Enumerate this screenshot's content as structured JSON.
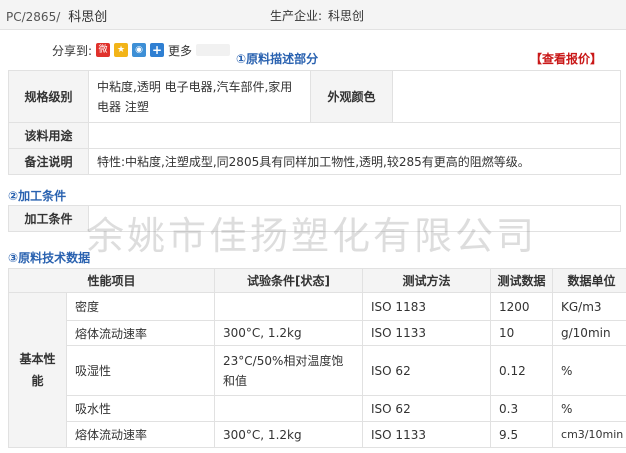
{
  "header": {
    "grade_code": "PC/2865/",
    "grade_brand": "科思创",
    "producer_label": "生产企业:",
    "producer_name": "科思创"
  },
  "share": {
    "label": "分享到:",
    "more": "更多",
    "icons": [
      "weibo-icon",
      "star-icon",
      "tqq-icon",
      "plus-icon"
    ]
  },
  "sections": {
    "desc_title": "①原料描述部分",
    "proc_title": "②加工条件",
    "tech_title": "③原料技术数据",
    "quote_link": "【查看报价】"
  },
  "desc_table": {
    "spec_label": "规格级别",
    "spec_value": "中粘度,透明 电子电器,汽车部件,家用电器 注塑",
    "color_label": "外观颜色",
    "color_value": "",
    "usage_label": "该料用途",
    "usage_value": "",
    "remark_label": "备注说明",
    "remark_value": "特性:中粘度,注塑成型,同2805具有同样加工物性,透明,较285有更高的阻燃等级。"
  },
  "proc_table": {
    "label": "加工条件",
    "value": ""
  },
  "tech_table": {
    "headers": [
      "性能项目",
      "试验条件[状态]",
      "测试方法",
      "测试数据",
      "数据单位"
    ],
    "group_label": "基本性能",
    "rows": [
      {
        "item": "密度",
        "condition": "",
        "method": "ISO 1183",
        "value": "1200",
        "unit": "KG/m3"
      },
      {
        "item": "熔体流动速率",
        "condition": "300°C, 1.2kg",
        "method": "ISO 1133",
        "value": "10",
        "unit": "g/10min"
      },
      {
        "item": "吸湿性",
        "condition": "23°C/50%相对温度饱和值",
        "method": "ISO 62",
        "value": "0.12",
        "unit": "%"
      },
      {
        "item": "吸水性",
        "condition": "",
        "method": "ISO 62",
        "value": "0.3",
        "unit": "%"
      },
      {
        "item": "熔体流动速率",
        "condition": "300°C, 1.2kg",
        "method": "ISO 1133",
        "value": "9.5",
        "unit": "cm3/10min"
      }
    ]
  },
  "watermark": "余姚市佳扬塑化有限公司"
}
